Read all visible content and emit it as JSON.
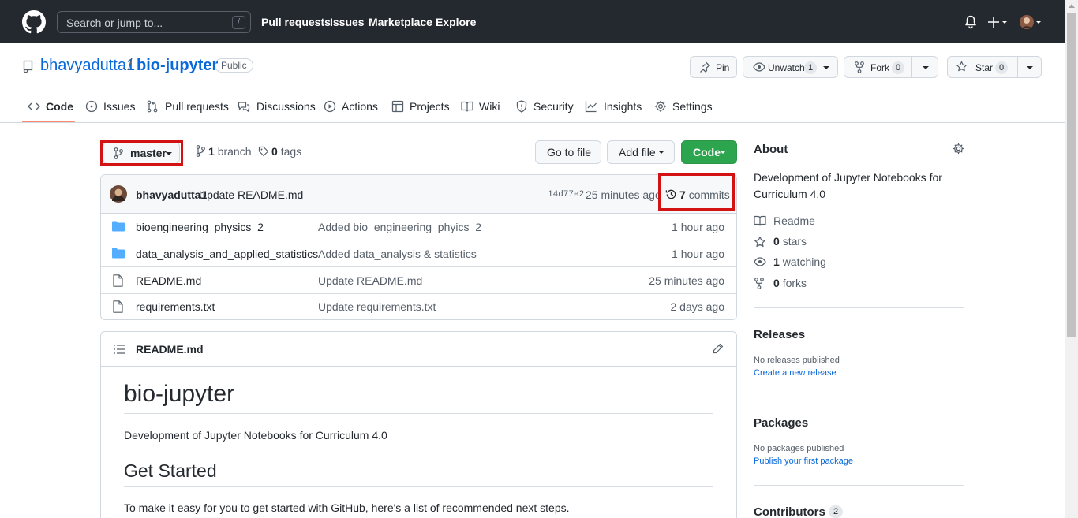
{
  "header": {
    "search_placeholder": "Search or jump to...",
    "search_shortcut": "/",
    "nav": [
      "Pull requests",
      "Issues",
      "Marketplace",
      "Explore"
    ]
  },
  "repo": {
    "owner": "bhavyadutta1",
    "separator": "/",
    "name": "bio-jupyter",
    "visibility": "Public",
    "pin_label": "Pin",
    "unwatch_label": "Unwatch",
    "unwatch_count": "1",
    "fork_label": "Fork",
    "fork_count": "0",
    "star_label": "Star",
    "star_count": "0"
  },
  "tabs": [
    "Code",
    "Issues",
    "Pull requests",
    "Discussions",
    "Actions",
    "Projects",
    "Wiki",
    "Security",
    "Insights",
    "Settings"
  ],
  "branch_bar": {
    "branch": "master",
    "branch_count": "1",
    "branch_word": "branch",
    "tag_count": "0",
    "tag_word": "tags",
    "go_to_file": "Go to file",
    "add_file": "Add file",
    "code": "Code"
  },
  "latest_commit": {
    "author": "bhavyadutta1",
    "message": "Update README.md",
    "sha": "14d77e2",
    "age": "25 minutes ago",
    "commit_count": "7",
    "commit_word": "commits"
  },
  "files": [
    {
      "type": "folder",
      "name": "bioengineering_physics_2",
      "message": "Added bio_engineering_phyics_2",
      "age": "1 hour ago"
    },
    {
      "type": "folder",
      "name": "data_analysis_and_applied_statistics",
      "message": "Added data_analysis & statistics",
      "age": "1 hour ago"
    },
    {
      "type": "file",
      "name": "README.md",
      "message": "Update README.md",
      "age": "25 minutes ago"
    },
    {
      "type": "file",
      "name": "requirements.txt",
      "message": "Update requirements.txt",
      "age": "2 days ago"
    }
  ],
  "readme": {
    "filename": "README.md",
    "title": "bio-jupyter",
    "description": "Development of Jupyter Notebooks for Curriculum 4.0",
    "section": "Get Started",
    "intro": "To make it easy for you to get started with GitHub, here's a list of recommended next steps."
  },
  "about": {
    "title": "About",
    "description": "Development of Jupyter Notebooks for Curriculum 4.0",
    "readme": "Readme",
    "stars_count": "0",
    "stars_word": "stars",
    "watching_count": "1",
    "watching_word": "watching",
    "forks_count": "0",
    "forks_word": "forks"
  },
  "releases": {
    "title": "Releases",
    "empty": "No releases published",
    "link": "Create a new release"
  },
  "packages": {
    "title": "Packages",
    "empty": "No packages published",
    "link": "Publish your first package"
  },
  "contributors": {
    "title": "Contributors",
    "count": "2"
  },
  "colors": {
    "header_bg": "#24292f",
    "link": "#0969da",
    "code_button": "#2da44e",
    "active_tab": "#fd8c73",
    "highlight_box": "#d31313"
  }
}
